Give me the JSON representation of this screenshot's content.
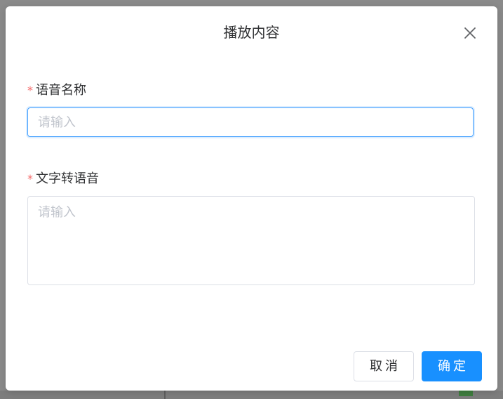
{
  "dialog": {
    "title": "播放内容",
    "close_icon": "close-icon"
  },
  "form": {
    "name_field": {
      "required_mark": "*",
      "label": "语音名称",
      "value": "",
      "placeholder": "请输入"
    },
    "tts_field": {
      "required_mark": "*",
      "label": "文字转语音",
      "value": "",
      "placeholder": "请输入"
    }
  },
  "footer": {
    "cancel_label": "取消",
    "ok_label": "确定"
  },
  "colors": {
    "primary": "#1890ff",
    "focus_border": "#409eff",
    "required": "#f56c6c",
    "overlay": "#8a8a8a"
  }
}
